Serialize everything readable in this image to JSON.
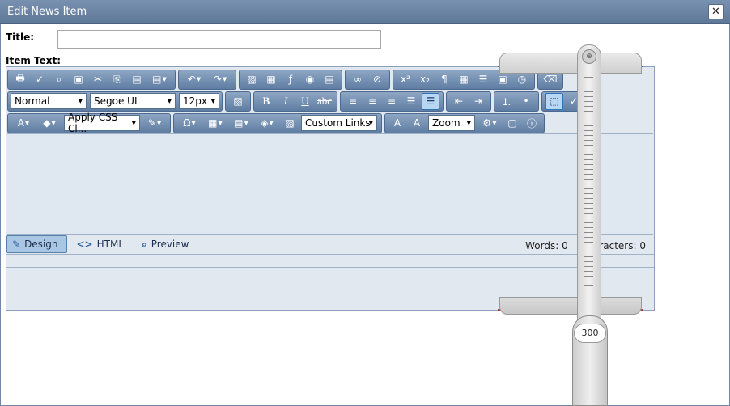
{
  "dialog": {
    "title": "Edit News Item",
    "close_glyph": "✕"
  },
  "form": {
    "title_label": "Title:",
    "title_value": "",
    "item_text_label": "Item Text:"
  },
  "toolbar": {
    "row1_icons": [
      "print-icon",
      "spellcheck-icon",
      "find-icon",
      "select-all-icon",
      "cut-icon",
      "copy-icon",
      "paste-icon",
      "paste-options-icon",
      "undo-icon",
      "redo-icon",
      "image-manager-icon",
      "document-manager-icon",
      "flash-manager-icon",
      "media-manager-icon",
      "template-manager-icon",
      "hyperlink-icon",
      "remove-link-icon",
      "superscript-icon",
      "subscript-icon",
      "paragraph-icon",
      "insert-date-icon",
      "horizontal-rule-icon",
      "insert-snippet-icon",
      "time-icon",
      "format-stripper-icon"
    ],
    "paragraph_style": "Normal",
    "font_name": "Segoe UI",
    "font_size": "12px",
    "css_class": "Apply CSS Cl...",
    "custom_links": "Custom Links",
    "zoom": "Zoom"
  },
  "modes": {
    "design": "Design",
    "html": "HTML",
    "preview": "Preview"
  },
  "status": {
    "words_label": "Words: 0",
    "characters_label": "Characters: 0"
  },
  "ruler": {
    "value": "300"
  },
  "colors": {
    "titlebar": "#6a84a6",
    "toolbar_group": "#7791b3",
    "editor_bg": "#e2e8ef"
  }
}
